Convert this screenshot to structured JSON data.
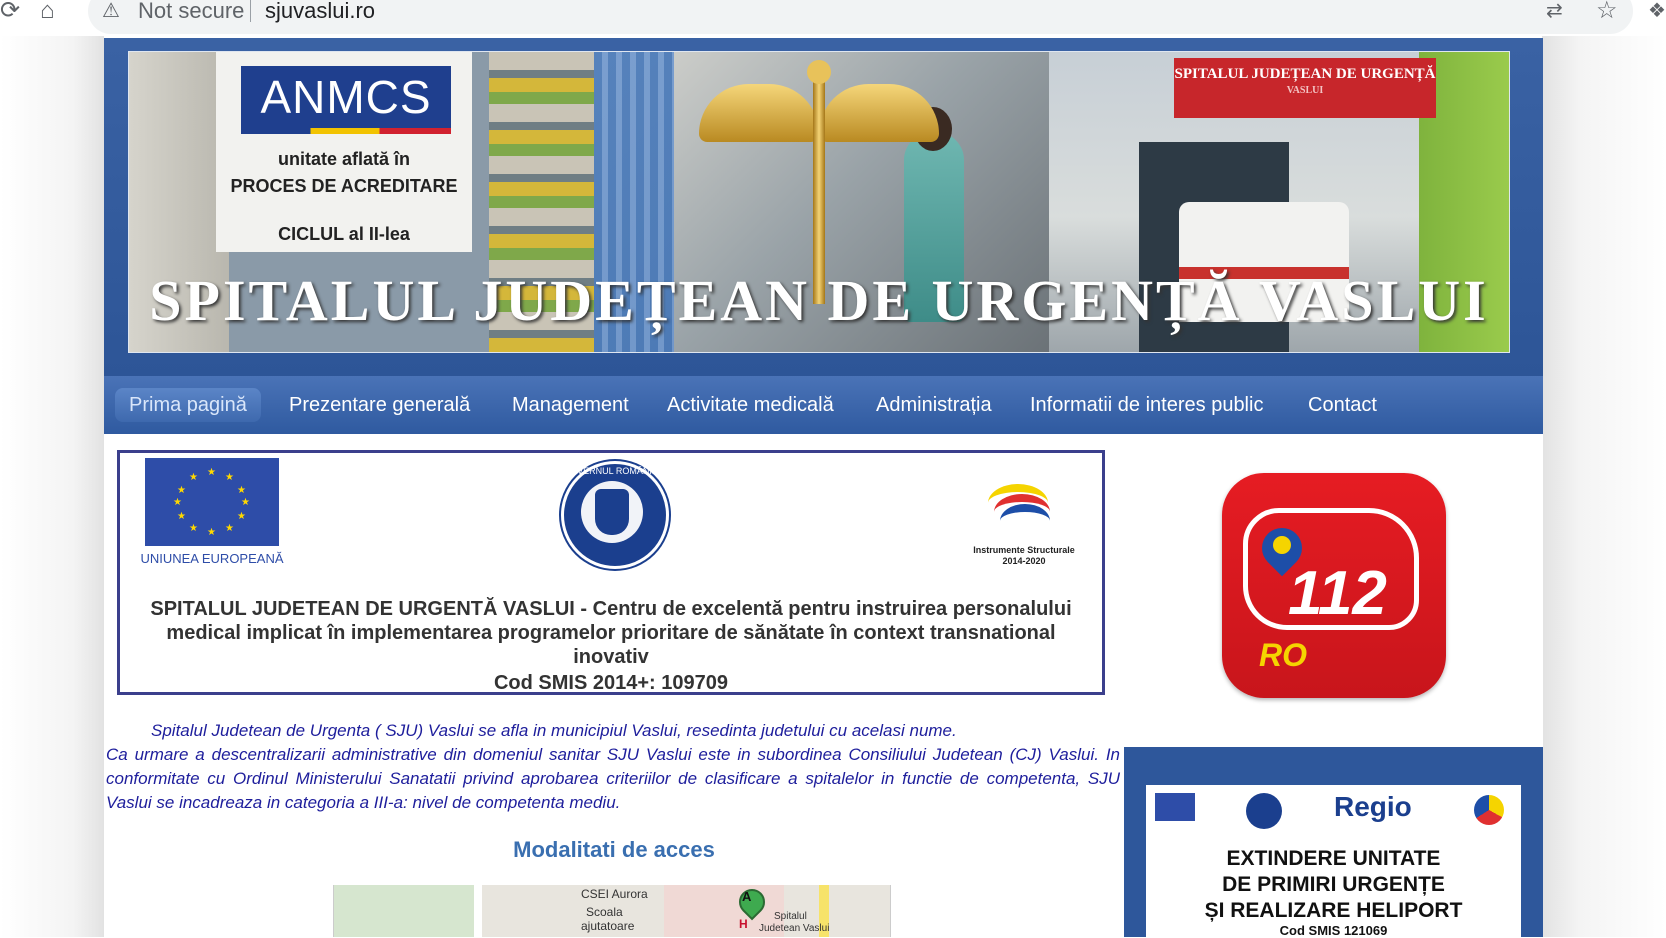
{
  "browser": {
    "security_label": "Not secure",
    "url": "sjuvaslui.ro",
    "icons": [
      "reload-icon",
      "home-icon",
      "warning-icon",
      "translate-icon",
      "star-icon",
      "extension-icon"
    ]
  },
  "banner": {
    "anmcs_logo": "ANMCS",
    "anmcs_line1": "unitate aflată în",
    "anmcs_line2": "PROCES DE ACREDITARE",
    "anmcs_line3": "CICLUL al II-lea",
    "sign_text": "SPITALUL JUDEȚEAN DE URGENȚĂ",
    "sign_text2": "VASLUI",
    "title": "SPITALUL JUDEȚEAN DE URGENȚĂ VASLUI"
  },
  "nav": {
    "items": [
      {
        "label": "Prima pagină",
        "active": true
      },
      {
        "label": "Prezentare generală"
      },
      {
        "label": "Management"
      },
      {
        "label": "Activitate medicală"
      },
      {
        "label": "Administrația"
      },
      {
        "label": "Informatii de interes public"
      },
      {
        "label": "Contact"
      }
    ]
  },
  "project": {
    "eu_label": "UNIUNEA EUROPEANĂ",
    "gov_label": "GUVERNUL ROMÂNIEI",
    "is_label": "Instrumente Structurale 2014-2020",
    "title": "SPITALUL JUDETEAN DE URGENTĂ VASLUI - Centru de excelentă pentru instruirea personalului medical implicat în implementarea programelor prioritare de sănătate în context transnational inovativ",
    "cod": "Cod SMIS 2014+: 109709"
  },
  "intro": {
    "p1": "Spitalul Judetean de Urgenta ( SJU) Vaslui se afla in municipiul Vaslui, resedinta judetului cu acelasi nume.",
    "p2": "Ca urmare a descentralizarii administrative din domeniul sanitar SJU Vaslui este in subordinea Consiliului Judetean (CJ) Vaslui.  In conformitate cu Ordinul Ministerului Sanatatii privind aprobarea criteriilor de clasificare a spitalelor in functie de competenta, SJU Vaslui se incadreaza in categoria a III-a: nivel de competenta mediu."
  },
  "access": {
    "title": "Modalitati de acces",
    "map_labels": [
      "CSEI Aurora",
      "Scoala",
      "ajutatoare",
      "Spitalul",
      "Judetean Vaslui"
    ],
    "pin_label": "A",
    "h_label": "H"
  },
  "sidebar": {
    "app_number": "112",
    "app_country": "RO",
    "regio_logo": "Regio",
    "regio_title_lines": [
      "EXTINDERE UNITATE",
      "DE PRIMIRI URGENȚE",
      "ȘI REALIZARE HELIPORT"
    ],
    "regio_cod": "Cod SMIS 121069"
  },
  "colors": {
    "header_blue": "#2d5597",
    "nav_blue": "#3a64a9",
    "intro_text": "#1e1e9c",
    "heading_blue": "#3a6fb0",
    "red_112": "#e61c23"
  }
}
